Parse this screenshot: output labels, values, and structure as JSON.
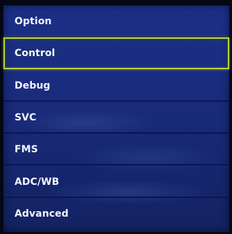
{
  "menu": {
    "title": "Option",
    "items": [
      {
        "label": "Control",
        "selected": true
      },
      {
        "label": "Debug"
      },
      {
        "label": "SVC"
      },
      {
        "label": "FMS"
      },
      {
        "label": "ADC/WB"
      },
      {
        "label": "Advanced"
      }
    ],
    "colors": {
      "background": "#1a2c7e",
      "highlight_border": "#b9d63a",
      "text": "#f2f4ff"
    }
  }
}
